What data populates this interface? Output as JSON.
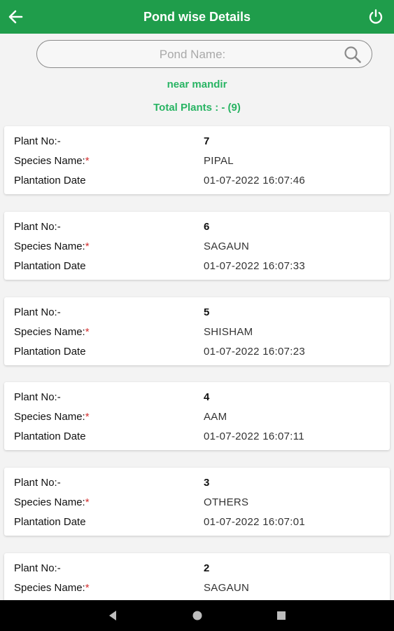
{
  "header": {
    "title": "Pond wise Details",
    "back_icon": "arrow-left-icon",
    "power_icon": "power-icon",
    "bg_color": "#1f9d4b"
  },
  "search": {
    "placeholder": "Pond Name:",
    "value": "",
    "icon": "search-icon"
  },
  "pond": {
    "name": "near mandir",
    "total_label": "Total Plants : - (9)"
  },
  "labels": {
    "plant_no": "Plant No:-",
    "species": "Species Name:",
    "required_mark": "*",
    "date": "Plantation Date"
  },
  "plants": [
    {
      "no": "7",
      "species": "PIPAL",
      "date": "01-07-2022 16:07:46"
    },
    {
      "no": "6",
      "species": "SAGAUN",
      "date": "01-07-2022 16:07:33"
    },
    {
      "no": "5",
      "species": "SHISHAM",
      "date": "01-07-2022 16:07:23"
    },
    {
      "no": "4",
      "species": "AAM",
      "date": "01-07-2022 16:07:11"
    },
    {
      "no": "3",
      "species": "OTHERS",
      "date": "01-07-2022 16:07:01"
    },
    {
      "no": "2",
      "species": "SAGAUN",
      "date": ""
    }
  ],
  "navbar": {
    "back": "nav-back-icon",
    "home": "nav-home-icon",
    "recents": "nav-recents-icon"
  }
}
